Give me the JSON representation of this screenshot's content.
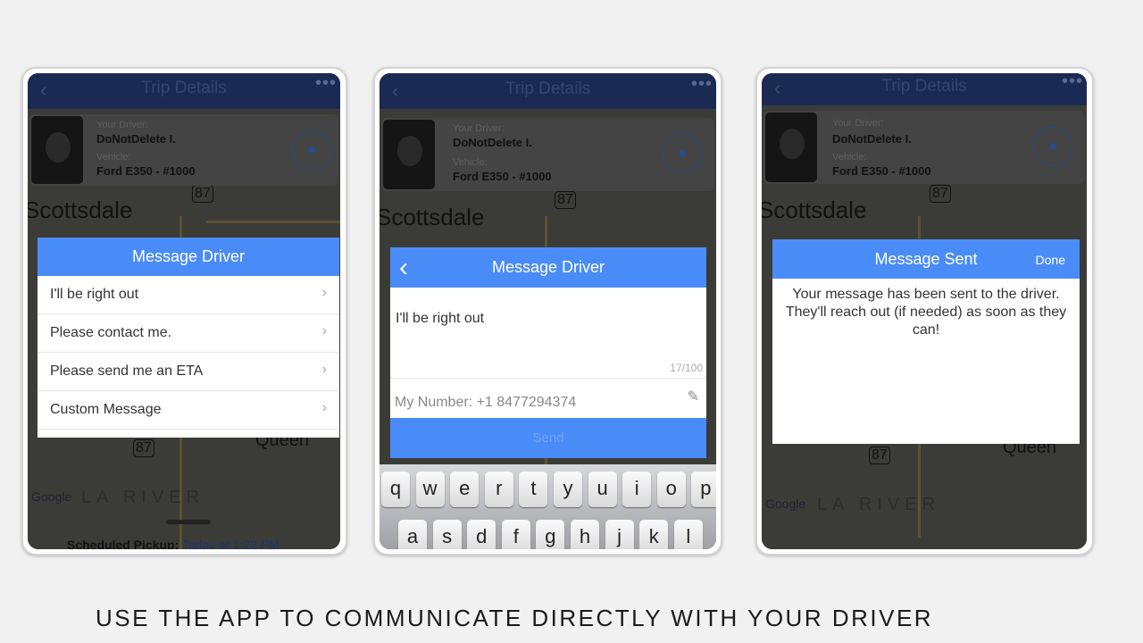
{
  "caption": "USE THE APP TO  COMMUNICATE DIRECTLY WITH YOUR DRIVER",
  "colors": {
    "accent": "#4a8cf7",
    "header": "#1a2a52",
    "background": "#f1f1f1"
  },
  "trip": {
    "title": "Trip Details",
    "back_icon": "chevron-left-icon",
    "more_icon": "ellipsis-icon",
    "driver_label": "Your Driver:",
    "driver_name": "DoNotDelete I.",
    "vehicle_label": "Vehicle:",
    "vehicle": "Ford E350 - #1000",
    "map_city": "Scottsdale",
    "map_route": "87",
    "map_place": "Queen",
    "map_area": "LA RIVER",
    "map_brand": "Google",
    "scheduled_label": "Scheduled Pickup:",
    "scheduled_value": "Today at 1:22 PM"
  },
  "screen1": {
    "title": "Message Driver",
    "options": [
      "I'll be right out",
      "Please contact me.",
      "Please send me an ETA",
      "Custom Message"
    ]
  },
  "screen2": {
    "title": "Message Driver",
    "message": "I'll be right out",
    "counter": "17/100",
    "number": "My Number: +1 8477294374",
    "send": "Send",
    "keys_row1": [
      "q",
      "w",
      "e",
      "r",
      "t",
      "y",
      "u",
      "i",
      "o",
      "p"
    ],
    "keys_row2": [
      "a",
      "s",
      "d",
      "f",
      "g",
      "h",
      "j",
      "k",
      "l"
    ]
  },
  "screen3": {
    "title": "Message Sent",
    "done": "Done",
    "body": "Your message has been sent to the driver. They'll reach out (if needed) as soon as they can!"
  }
}
